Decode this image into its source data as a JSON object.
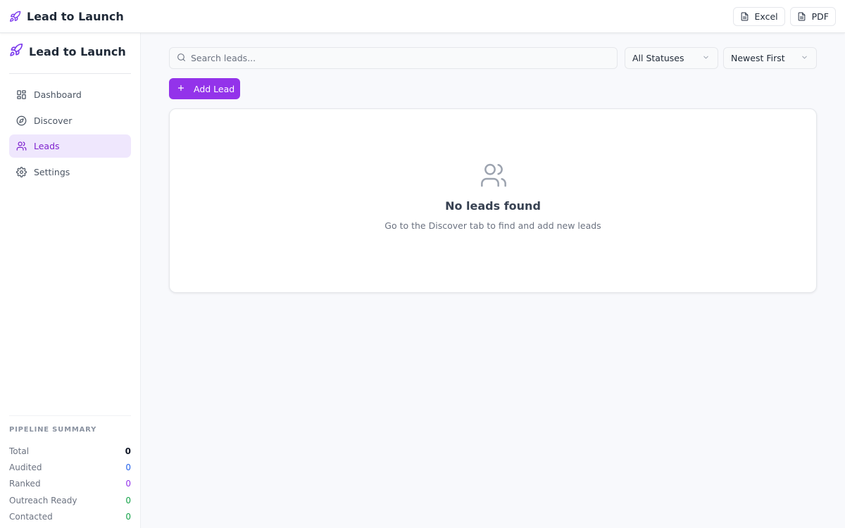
{
  "app": {
    "title": "Lead to Launch"
  },
  "header": {
    "excel_label": "Excel",
    "pdf_label": "PDF"
  },
  "sidebar": {
    "brand": "Lead to Launch",
    "items": [
      {
        "label": "Dashboard",
        "icon": "grid-icon"
      },
      {
        "label": "Discover",
        "icon": "compass-icon"
      },
      {
        "label": "Leads",
        "icon": "users-icon",
        "active": true
      },
      {
        "label": "Settings",
        "icon": "gear-icon"
      }
    ],
    "pipeline": {
      "title": "PIPELINE SUMMARY",
      "rows": [
        {
          "label": "Total",
          "value": "0",
          "color": "#111827"
        },
        {
          "label": "Audited",
          "value": "0",
          "color": "#2563eb"
        },
        {
          "label": "Ranked",
          "value": "0",
          "color": "#9333ea"
        },
        {
          "label": "Outreach Ready",
          "value": "0",
          "color": "#16a34a"
        },
        {
          "label": "Contacted",
          "value": "0",
          "color": "#16a34a"
        }
      ]
    }
  },
  "toolbar": {
    "search_placeholder": "Search leads...",
    "search_value": "",
    "status_filter": "All Statuses",
    "sort": "Newest First",
    "add_label": "Add Lead"
  },
  "empty_state": {
    "icon": "users-icon",
    "title": "No leads found",
    "subtitle": "Go to the Discover tab to find and add new leads"
  },
  "colors": {
    "accent": "#9333ea",
    "active_bg": "#efe7fd"
  }
}
